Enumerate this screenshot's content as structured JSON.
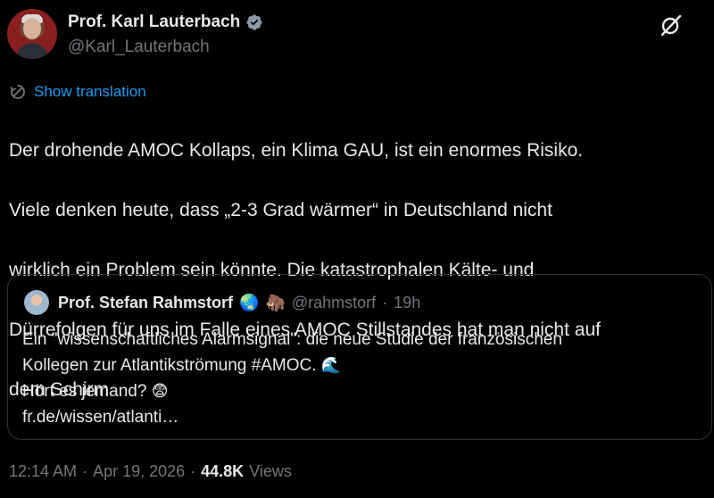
{
  "author": {
    "display_name": "Prof. Karl Lauterbach",
    "handle": "@Karl_Lauterbach",
    "verified": true,
    "verified_color": "#8b98a5"
  },
  "translate": {
    "label": "Show translation",
    "icon": "translate-icon",
    "color": "#1d9bf0"
  },
  "tweet": {
    "text_lines": [
      "Der drohende AMOC Kollaps, ein Klima GAU, ist ein enormes Risiko.",
      "Viele denken heute, dass „2-3 Grad wärmer“ in Deutschland nicht",
      "wirklich ein Problem sein könnte. Die katastrophalen Kälte- und",
      "Dürrefolgen für uns im Falle eines AMOC Stillstandes hat man nicht auf",
      "dem Schirm"
    ]
  },
  "quote": {
    "display_name": "Prof. Stefan Rahmstorf",
    "name_emojis": [
      "🌏",
      "🦣"
    ],
    "handle": "@rahmstorf",
    "separator": "·",
    "time": "19h",
    "lines": [
      "Ein \"wissenschaftliches Alarmsignal\": die neue Studie der französischen",
      "Kollegen zur Atlantikströmung #AMOC.",
      "Hört es jemand?",
      " fr.de/wissen/atlanti…"
    ],
    "line_emojis": [
      "",
      "🌊",
      "😨",
      ""
    ]
  },
  "meta": {
    "time": "12:14 AM",
    "separator": "·",
    "date": "Apr 19, 2026",
    "separator2": "·",
    "views_count": "44.8K",
    "views_label": "Views"
  },
  "colors": {
    "background": "#000000",
    "text": "#e7e9ea",
    "secondary": "#71767b",
    "border": "#2f3336",
    "link": "#1d9bf0"
  },
  "icons": {
    "grok": "grok-icon"
  }
}
